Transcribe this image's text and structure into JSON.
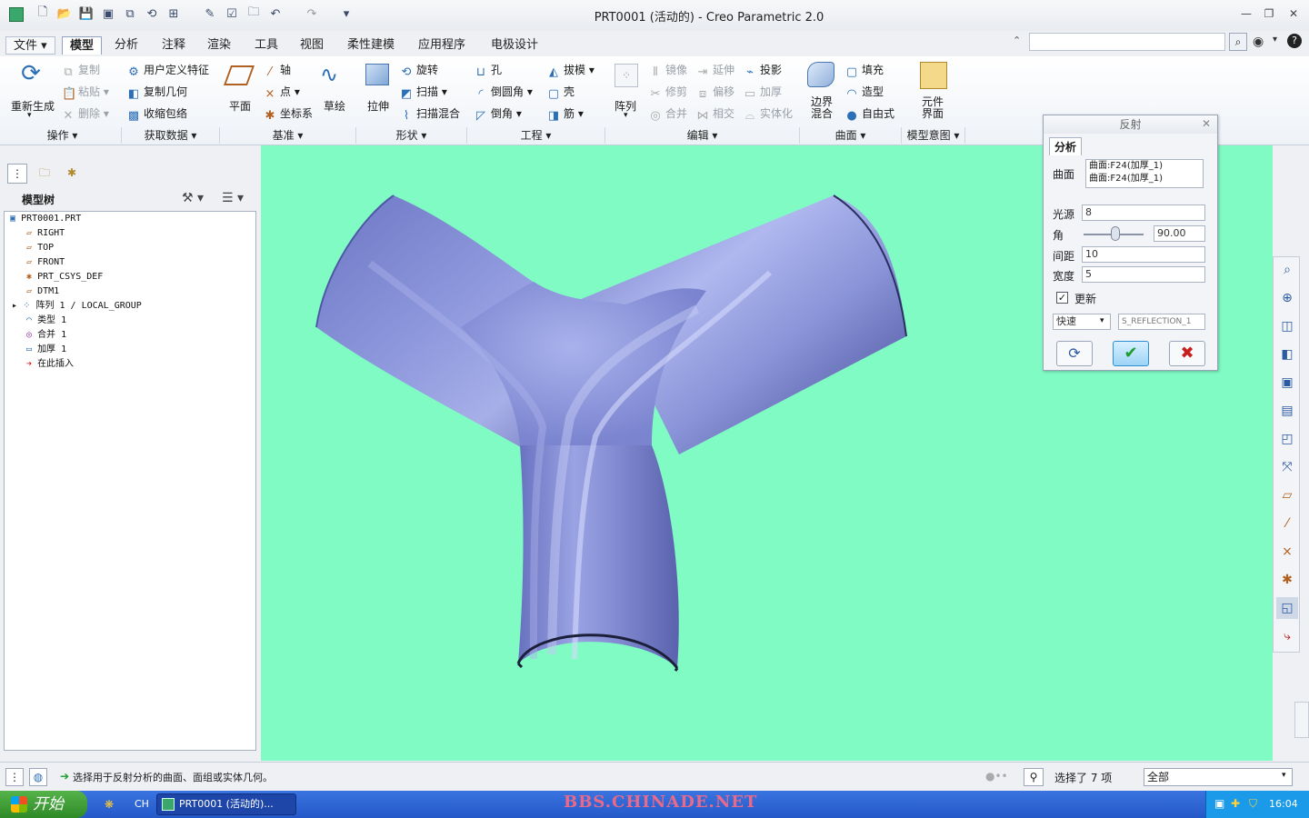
{
  "window": {
    "title": "PRT0001 (活动的) - Creo Parametric 2.0"
  },
  "menu_tabs": [
    "文件 ▾",
    "模型",
    "分析",
    "注释",
    "渲染",
    "工具",
    "视图",
    "柔性建模",
    "应用程序",
    "电极设计"
  ],
  "ribbon": {
    "regenerate": "重新生成",
    "copy": "复制",
    "paste": "粘贴",
    "delete": "删除",
    "udf": "用户定义特征",
    "copy_geom": "复制几何",
    "shrinkwrap": "收缩包络",
    "plane": "平面",
    "axis": "轴",
    "point": "点",
    "csys": "坐标系",
    "sketch": "草绘",
    "extrude": "拉伸",
    "revolve": "旋转",
    "sweep": "扫描",
    "swept_blend": "扫描混合",
    "hole": "孔",
    "draft": "拔模",
    "round": "倒圆角",
    "shell": "壳",
    "chamfer": "倒角",
    "rib": "筋",
    "pattern": "阵列",
    "mirror": "镜像",
    "extend": "延伸",
    "project": "投影",
    "trim": "修剪",
    "offset": "偏移",
    "thicken": "加厚",
    "merge": "合并",
    "intersect": "相交",
    "solidify": "实体化",
    "boundary_blend": "边界\n混合",
    "fill": "填充",
    "style": "造型",
    "freestyle": "自由式",
    "component_interface": "元件\n界面"
  },
  "groups": [
    "操作 ▾",
    "获取数据 ▾",
    "基准 ▾",
    "形状 ▾",
    "工程 ▾",
    "编辑 ▾",
    "曲面 ▾",
    "模型意图 ▾"
  ],
  "model_tree": {
    "title": "模型树",
    "items": [
      "PRT0001.PRT",
      "RIGHT",
      "TOP",
      "FRONT",
      "PRT_CSYS_DEF",
      "DTM1",
      "阵列 1 / LOCAL_GROUP",
      "类型 1",
      "合并 1",
      "加厚 1",
      "在此插入"
    ]
  },
  "dialog": {
    "title": "反射",
    "tab": "分析",
    "surface_label": "曲面",
    "surfaces": [
      "曲面:F24(加厚_1)",
      "曲面:F24(加厚_1)"
    ],
    "light_label": "光源",
    "light_value": "8",
    "angle_label": "角",
    "angle_value": "90.00",
    "spacing_label": "间距",
    "spacing_value": "10",
    "width_label": "宽度",
    "width_value": "5",
    "update_label": "更新",
    "mode_value": "快速",
    "result_name": "S_REFLECTION_1"
  },
  "status": {
    "message": "选择用于反射分析的曲面、面组或实体几何。",
    "selected": "选择了 7 项",
    "filter": "全部"
  },
  "taskbar": {
    "start": "开始",
    "lang": "CH",
    "task": "PRT0001 (活动的)...",
    "watermark": "BBS.CHINADE.NET",
    "clock": "16:04"
  },
  "colors": {
    "viewport_bg": "#80fbc4",
    "model_fill": "#8690d6",
    "accept_green": "#1a9d2a",
    "cancel_red": "#c81e1e"
  }
}
